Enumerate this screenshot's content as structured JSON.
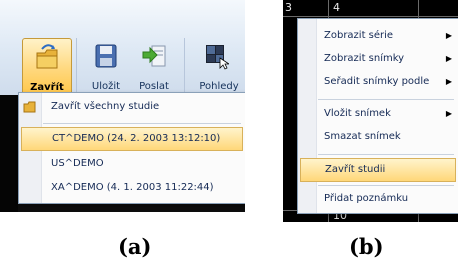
{
  "panel_a": {
    "toolbar": {
      "buttons": [
        {
          "label": "Zavřít",
          "icon": "folder-close-icon",
          "active": true
        },
        {
          "label": "Uložit",
          "icon": "floppy-disk-icon",
          "active": false
        },
        {
          "label": "Poslat",
          "icon": "send-arrow-icon",
          "active": false
        },
        {
          "label": "Pohledy",
          "icon": "grid-views-icon",
          "active": false
        }
      ]
    },
    "menu": {
      "items": [
        {
          "label": "Zavřít všechny studie",
          "icon": "folder-icon"
        },
        {
          "label": "CT^DEMO (24. 2. 2003 13:12:10)",
          "highlighted": true
        },
        {
          "label": "US^DEMO"
        },
        {
          "label": "XA^DEMO (4. 1. 2003 11:22:44)"
        }
      ]
    },
    "caption": "(a)"
  },
  "panel_b": {
    "viewport_numbers": [
      "3",
      "4",
      "10"
    ],
    "menu": {
      "items": [
        {
          "label": "Zobrazit série",
          "submenu": true
        },
        {
          "label": "Zobrazit snímky",
          "submenu": true
        },
        {
          "label": "Seřadit snímky podle",
          "submenu": true
        },
        {
          "label": "Vložit snímek",
          "submenu": true
        },
        {
          "label": "Smazat snímek",
          "submenu": false
        },
        {
          "label": "Zavřít studii",
          "submenu": false,
          "highlighted": true
        },
        {
          "label": "Přidat poznámku",
          "submenu": false
        }
      ]
    },
    "caption": "(b)"
  },
  "colors": {
    "ribbon": "#dde8f4",
    "highlight": "#ffd779",
    "menu_text": "#152a55"
  }
}
